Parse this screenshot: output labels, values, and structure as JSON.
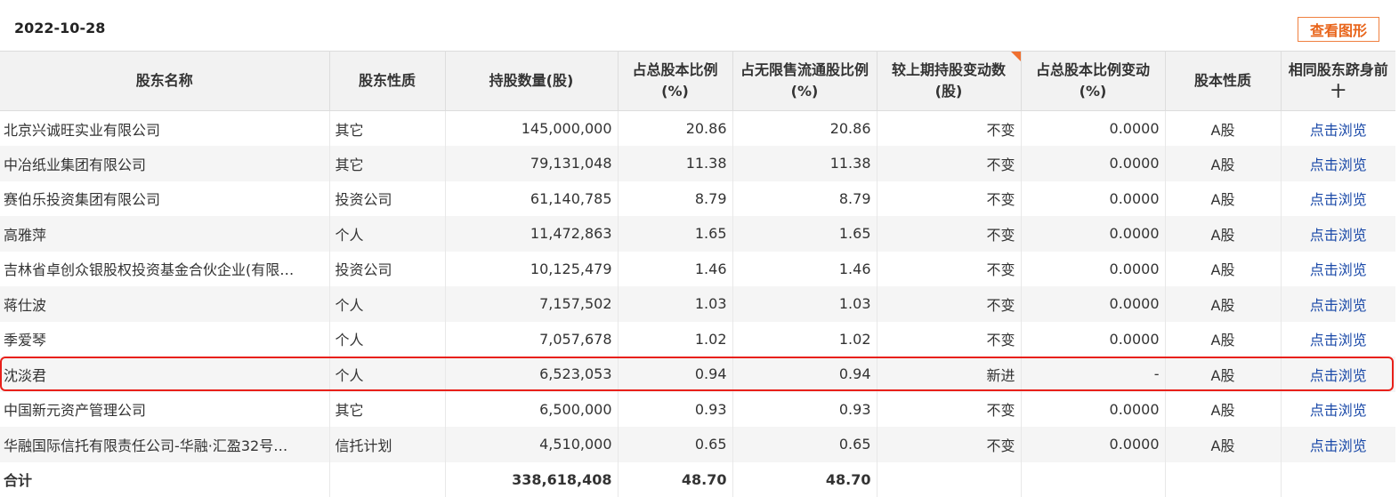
{
  "header": {
    "date": "2022-10-28",
    "chart_button_label": "查看图形"
  },
  "table": {
    "columns": [
      "股东名称",
      "股东性质",
      "持股数量(股)",
      "占总股本比例(%)",
      "占无限售流通股比例(%)",
      "较上期持股变动数(股)",
      "占总股本比例变动(%)",
      "股本性质",
      "相同股东跻身前十"
    ],
    "rows": [
      {
        "name": "北京兴诚旺实业有限公司",
        "type": "其它",
        "shares": "145,000,000",
        "pct_total": "20.86",
        "pct_float": "20.86",
        "change": "不变",
        "pct_change": "0.0000",
        "share_class": "A股",
        "link": "点击浏览"
      },
      {
        "name": "中冶纸业集团有限公司",
        "type": "其它",
        "shares": "79,131,048",
        "pct_total": "11.38",
        "pct_float": "11.38",
        "change": "不变",
        "pct_change": "0.0000",
        "share_class": "A股",
        "link": "点击浏览"
      },
      {
        "name": "赛伯乐投资集团有限公司",
        "type": "投资公司",
        "shares": "61,140,785",
        "pct_total": "8.79",
        "pct_float": "8.79",
        "change": "不变",
        "pct_change": "0.0000",
        "share_class": "A股",
        "link": "点击浏览"
      },
      {
        "name": "高雅萍",
        "type": "个人",
        "shares": "11,472,863",
        "pct_total": "1.65",
        "pct_float": "1.65",
        "change": "不变",
        "pct_change": "0.0000",
        "share_class": "A股",
        "link": "点击浏览"
      },
      {
        "name": "吉林省卓创众银股权投资基金合伙企业(有限…",
        "type": "投资公司",
        "shares": "10,125,479",
        "pct_total": "1.46",
        "pct_float": "1.46",
        "change": "不变",
        "pct_change": "0.0000",
        "share_class": "A股",
        "link": "点击浏览"
      },
      {
        "name": "蒋仕波",
        "type": "个人",
        "shares": "7,157,502",
        "pct_total": "1.03",
        "pct_float": "1.03",
        "change": "不变",
        "pct_change": "0.0000",
        "share_class": "A股",
        "link": "点击浏览"
      },
      {
        "name": "季爱琴",
        "type": "个人",
        "shares": "7,057,678",
        "pct_total": "1.02",
        "pct_float": "1.02",
        "change": "不变",
        "pct_change": "0.0000",
        "share_class": "A股",
        "link": "点击浏览"
      },
      {
        "name": "沈淡君",
        "type": "个人",
        "shares": "6,523,053",
        "pct_total": "0.94",
        "pct_float": "0.94",
        "change": "新进",
        "pct_change": "-",
        "share_class": "A股",
        "link": "点击浏览"
      },
      {
        "name": "中国新元资产管理公司",
        "type": "其它",
        "shares": "6,500,000",
        "pct_total": "0.93",
        "pct_float": "0.93",
        "change": "不变",
        "pct_change": "0.0000",
        "share_class": "A股",
        "link": "点击浏览"
      },
      {
        "name": "华融国际信托有限责任公司-华融·汇盈32号…",
        "type": "信托计划",
        "shares": "4,510,000",
        "pct_total": "0.65",
        "pct_float": "0.65",
        "change": "不变",
        "pct_change": "0.0000",
        "share_class": "A股",
        "link": "点击浏览"
      }
    ],
    "total": {
      "label": "合计",
      "shares": "338,618,408",
      "pct_total": "48.70",
      "pct_float": "48.70"
    }
  },
  "colors": {
    "accent": "#e8641a",
    "link": "#1a49a8",
    "highlight_border": "#e8201a",
    "header_bg": "#f2f2f2",
    "stripe_bg": "#f5f5f5"
  }
}
